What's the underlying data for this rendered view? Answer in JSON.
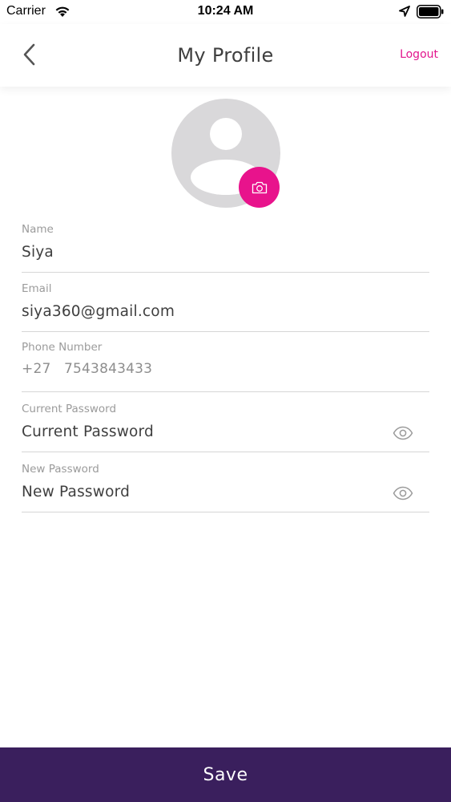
{
  "status_bar": {
    "carrier": "Carrier",
    "time": "10:24 AM"
  },
  "header": {
    "title": "My Profile",
    "logout_label": "Logout"
  },
  "profile": {
    "name_label": "Name",
    "name_value": "Siya",
    "email_label": "Email",
    "email_value": "siya360@gmail.com",
    "phone_label": "Phone Number",
    "phone_code": "+27",
    "phone_number": "7543843433",
    "current_password_label": "Current Password",
    "current_password_placeholder": "Current Password",
    "new_password_label": "New Password",
    "new_password_placeholder": "New Password"
  },
  "actions": {
    "save_label": "Save"
  },
  "colors": {
    "accent": "#e8138c",
    "save_bar": "#3a1f5d",
    "avatar_bg": "#d9d8da"
  },
  "icons": {
    "back": "chevron-left-icon",
    "camera": "camera-icon",
    "password_toggle": "eye-icon",
    "wifi": "wifi-icon",
    "location": "location-arrow-icon",
    "battery": "battery-icon"
  }
}
